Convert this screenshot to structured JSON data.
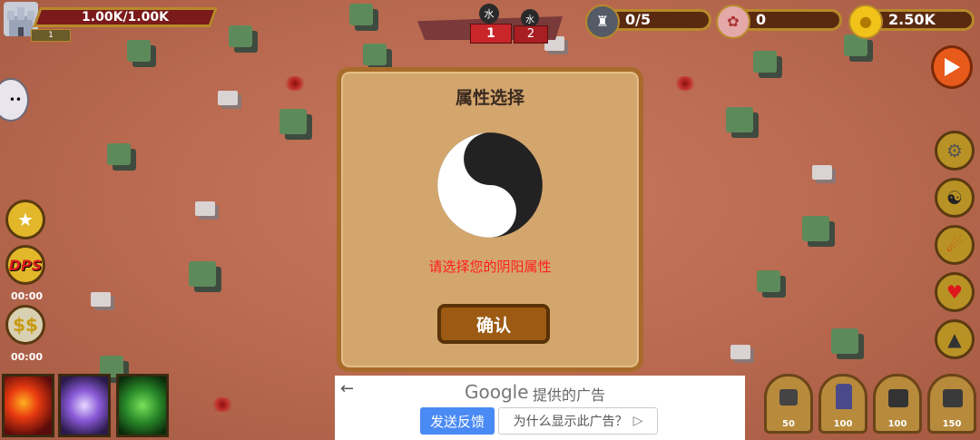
{
  "hud": {
    "base_hp": "1.00K/1.00K",
    "base_level": "1",
    "wave_element_1": "水",
    "wave_element_2": "水",
    "wave_num_1": "1",
    "wave_num_2": "2",
    "towers": "0/5",
    "gems": "0",
    "gold": "2.50K"
  },
  "left_panel": {
    "dps_label": "DPS",
    "timer_1": "00:00",
    "timer_2": "00:00"
  },
  "dialog": {
    "title": "属性选择",
    "message": "请选择您的阴阳属性",
    "confirm_label": "确认"
  },
  "ad": {
    "logo": "Google",
    "provided": "提供的广告",
    "feedback_label": "发送反馈",
    "why_label": "为什么显示此广告？"
  },
  "tower_costs": [
    "50",
    "100",
    "100",
    "150"
  ],
  "colors": {
    "message": "#ff1e1e",
    "dialog_bg": "#d3a66d",
    "ad_button": "#4a8af4"
  }
}
